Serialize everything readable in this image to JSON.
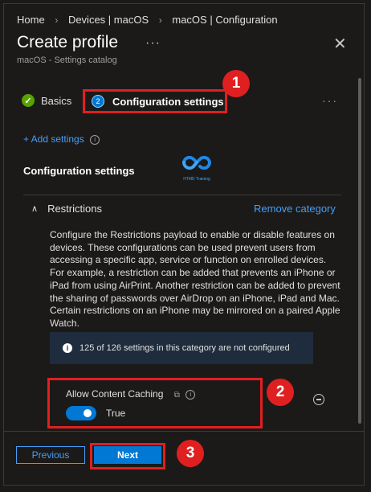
{
  "breadcrumb": [
    "Home",
    "Devices | macOS",
    "macOS | Configuration"
  ],
  "header": {
    "title": "Create profile",
    "subtitle": "macOS - Settings catalog",
    "more": "···",
    "close": "✕"
  },
  "steps": [
    {
      "label": "Basics",
      "status": "complete",
      "icon": "check-icon"
    },
    {
      "label": "Configuration settings",
      "number": "2",
      "status": "current"
    }
  ],
  "steps_more": "···",
  "add_settings": "+ Add settings",
  "section_title": "Configuration settings",
  "logo_text": "HTMD Training",
  "category": {
    "name": "Restrictions",
    "remove_label": "Remove category",
    "description": "Configure the Restrictions payload to enable or disable features on devices. These configurations can be used prevent users from accessing a specific app, service or function on enrolled devices. For example, a restriction can be added that prevents an iPhone or iPad from using AirPrint. Another restriction can be added to prevent the sharing of passwords over AirDrop on an iPhone, iPad and Mac. Certain restrictions on an iPhone may be mirrored on a paired Apple Watch.",
    "info_message": "125 of 126 settings in this category are not configured"
  },
  "setting": {
    "label": "Allow Content Caching",
    "value": "True",
    "enabled": true
  },
  "footer": {
    "previous": "Previous",
    "next": "Next"
  },
  "annotations": [
    "1",
    "2",
    "3"
  ],
  "colors": {
    "accent": "#0078d4",
    "link": "#479ef5",
    "highlight": "#e02020",
    "success": "#57a300",
    "background": "#1b1a19"
  }
}
